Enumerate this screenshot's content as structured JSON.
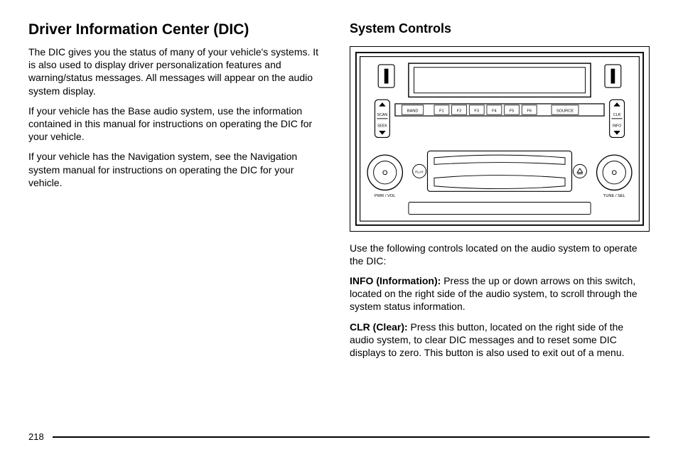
{
  "left": {
    "title": "Driver Information Center (DIC)",
    "p1": "The DIC gives you the status of many of your vehicle's systems. It is also used to display driver personalization features and warning/status messages. All messages will appear on the audio system display.",
    "p2": "If your vehicle has the Base audio system, use the information contained in this manual for instructions on operating the DIC for your vehicle.",
    "p3": "If your vehicle has the Navigation system, see the Navigation system manual for instructions on operating the DIC for your vehicle."
  },
  "right": {
    "title": "System Controls",
    "caption": "Use the following controls located on the audio system to operate the DIC:",
    "info_label": "INFO (Information):",
    "info_text": "  Press the up or down arrows on this switch, located on the right side of the audio system, to scroll through the system status information.",
    "clr_label": "CLR (Clear):",
    "clr_text": "  Press this button, located on the right side of the audio system, to clear DIC messages and to reset some DIC displays to zero. This button is also used to exit out of a menu."
  },
  "figure": {
    "band": "BAND",
    "f1": "F1",
    "f2": "F2",
    "f3": "F3",
    "f4": "F4",
    "f5": "F5",
    "f6": "F6",
    "source": "SOURCE",
    "scan": "SCAN",
    "seek": "SEEK",
    "clr": "CLR",
    "info": "INFO",
    "play": "PLAY",
    "pwr": "PWR / VOL",
    "tune": "TUNE / SEL"
  },
  "page_number": "218"
}
